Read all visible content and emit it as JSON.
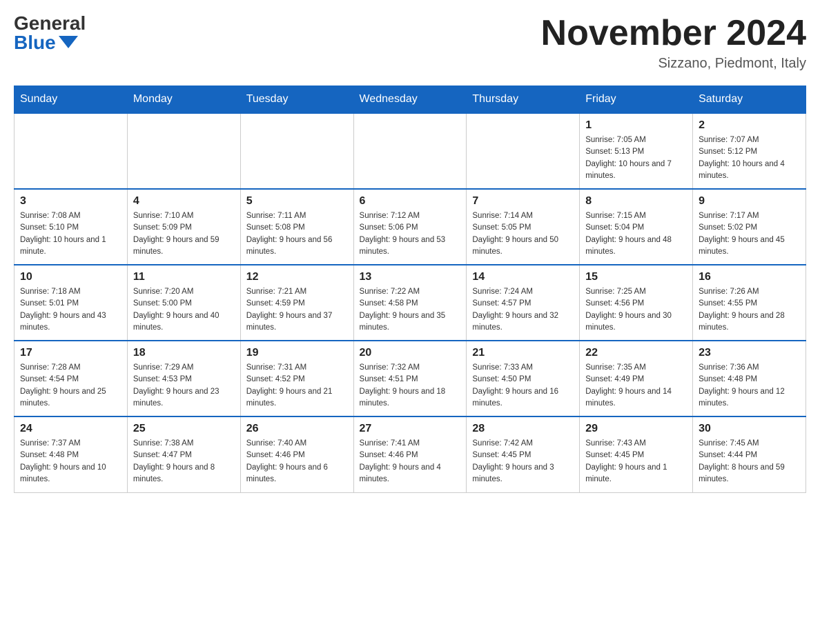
{
  "header": {
    "logo_general": "General",
    "logo_blue": "Blue",
    "month_title": "November 2024",
    "location": "Sizzano, Piedmont, Italy"
  },
  "days_of_week": [
    "Sunday",
    "Monday",
    "Tuesday",
    "Wednesday",
    "Thursday",
    "Friday",
    "Saturday"
  ],
  "weeks": [
    [
      {
        "day": "",
        "info": ""
      },
      {
        "day": "",
        "info": ""
      },
      {
        "day": "",
        "info": ""
      },
      {
        "day": "",
        "info": ""
      },
      {
        "day": "",
        "info": ""
      },
      {
        "day": "1",
        "info": "Sunrise: 7:05 AM\nSunset: 5:13 PM\nDaylight: 10 hours and 7 minutes."
      },
      {
        "day": "2",
        "info": "Sunrise: 7:07 AM\nSunset: 5:12 PM\nDaylight: 10 hours and 4 minutes."
      }
    ],
    [
      {
        "day": "3",
        "info": "Sunrise: 7:08 AM\nSunset: 5:10 PM\nDaylight: 10 hours and 1 minute."
      },
      {
        "day": "4",
        "info": "Sunrise: 7:10 AM\nSunset: 5:09 PM\nDaylight: 9 hours and 59 minutes."
      },
      {
        "day": "5",
        "info": "Sunrise: 7:11 AM\nSunset: 5:08 PM\nDaylight: 9 hours and 56 minutes."
      },
      {
        "day": "6",
        "info": "Sunrise: 7:12 AM\nSunset: 5:06 PM\nDaylight: 9 hours and 53 minutes."
      },
      {
        "day": "7",
        "info": "Sunrise: 7:14 AM\nSunset: 5:05 PM\nDaylight: 9 hours and 50 minutes."
      },
      {
        "day": "8",
        "info": "Sunrise: 7:15 AM\nSunset: 5:04 PM\nDaylight: 9 hours and 48 minutes."
      },
      {
        "day": "9",
        "info": "Sunrise: 7:17 AM\nSunset: 5:02 PM\nDaylight: 9 hours and 45 minutes."
      }
    ],
    [
      {
        "day": "10",
        "info": "Sunrise: 7:18 AM\nSunset: 5:01 PM\nDaylight: 9 hours and 43 minutes."
      },
      {
        "day": "11",
        "info": "Sunrise: 7:20 AM\nSunset: 5:00 PM\nDaylight: 9 hours and 40 minutes."
      },
      {
        "day": "12",
        "info": "Sunrise: 7:21 AM\nSunset: 4:59 PM\nDaylight: 9 hours and 37 minutes."
      },
      {
        "day": "13",
        "info": "Sunrise: 7:22 AM\nSunset: 4:58 PM\nDaylight: 9 hours and 35 minutes."
      },
      {
        "day": "14",
        "info": "Sunrise: 7:24 AM\nSunset: 4:57 PM\nDaylight: 9 hours and 32 minutes."
      },
      {
        "day": "15",
        "info": "Sunrise: 7:25 AM\nSunset: 4:56 PM\nDaylight: 9 hours and 30 minutes."
      },
      {
        "day": "16",
        "info": "Sunrise: 7:26 AM\nSunset: 4:55 PM\nDaylight: 9 hours and 28 minutes."
      }
    ],
    [
      {
        "day": "17",
        "info": "Sunrise: 7:28 AM\nSunset: 4:54 PM\nDaylight: 9 hours and 25 minutes."
      },
      {
        "day": "18",
        "info": "Sunrise: 7:29 AM\nSunset: 4:53 PM\nDaylight: 9 hours and 23 minutes."
      },
      {
        "day": "19",
        "info": "Sunrise: 7:31 AM\nSunset: 4:52 PM\nDaylight: 9 hours and 21 minutes."
      },
      {
        "day": "20",
        "info": "Sunrise: 7:32 AM\nSunset: 4:51 PM\nDaylight: 9 hours and 18 minutes."
      },
      {
        "day": "21",
        "info": "Sunrise: 7:33 AM\nSunset: 4:50 PM\nDaylight: 9 hours and 16 minutes."
      },
      {
        "day": "22",
        "info": "Sunrise: 7:35 AM\nSunset: 4:49 PM\nDaylight: 9 hours and 14 minutes."
      },
      {
        "day": "23",
        "info": "Sunrise: 7:36 AM\nSunset: 4:48 PM\nDaylight: 9 hours and 12 minutes."
      }
    ],
    [
      {
        "day": "24",
        "info": "Sunrise: 7:37 AM\nSunset: 4:48 PM\nDaylight: 9 hours and 10 minutes."
      },
      {
        "day": "25",
        "info": "Sunrise: 7:38 AM\nSunset: 4:47 PM\nDaylight: 9 hours and 8 minutes."
      },
      {
        "day": "26",
        "info": "Sunrise: 7:40 AM\nSunset: 4:46 PM\nDaylight: 9 hours and 6 minutes."
      },
      {
        "day": "27",
        "info": "Sunrise: 7:41 AM\nSunset: 4:46 PM\nDaylight: 9 hours and 4 minutes."
      },
      {
        "day": "28",
        "info": "Sunrise: 7:42 AM\nSunset: 4:45 PM\nDaylight: 9 hours and 3 minutes."
      },
      {
        "day": "29",
        "info": "Sunrise: 7:43 AM\nSunset: 4:45 PM\nDaylight: 9 hours and 1 minute."
      },
      {
        "day": "30",
        "info": "Sunrise: 7:45 AM\nSunset: 4:44 PM\nDaylight: 8 hours and 59 minutes."
      }
    ]
  ]
}
